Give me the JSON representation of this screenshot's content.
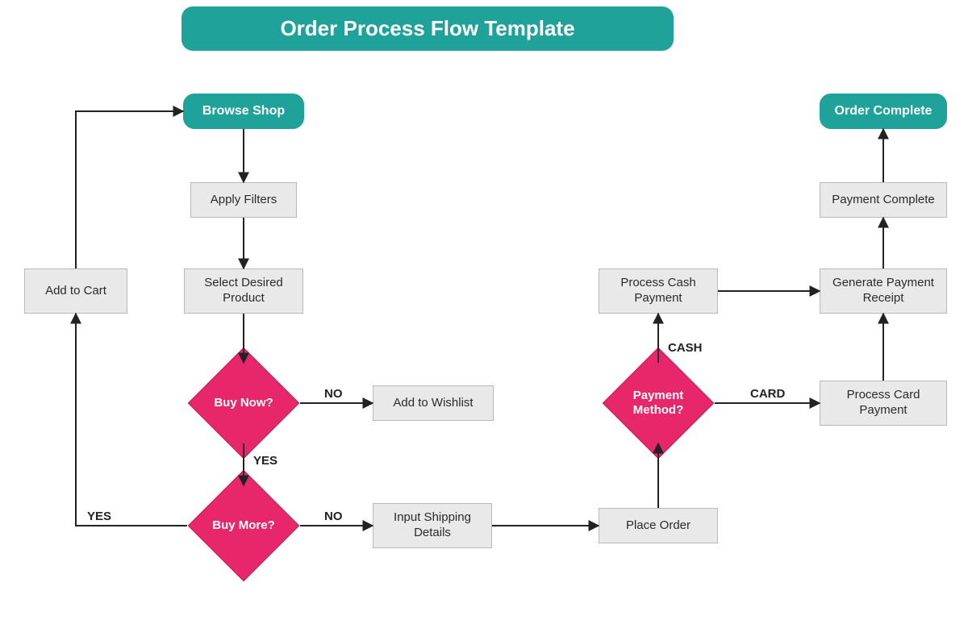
{
  "title": "Order Process Flow Template",
  "nodes": {
    "browse_shop": "Browse Shop",
    "apply_filters": "Apply Filters",
    "select_product": "Select Desired Product",
    "buy_now": "Buy Now?",
    "add_wishlist": "Add to Wishlist",
    "buy_more": "Buy More?",
    "add_cart": "Add to Cart",
    "input_shipping": "Input Shipping Details",
    "place_order": "Place Order",
    "payment_method": "Payment Method?",
    "process_cash": "Process Cash Payment",
    "process_card": "Process Card Payment",
    "generate_receipt": "Generate Payment Receipt",
    "payment_complete": "Payment Complete",
    "order_complete": "Order Complete"
  },
  "edge_labels": {
    "buy_now_no": "NO",
    "buy_now_yes": "YES",
    "buy_more_yes": "YES",
    "buy_more_no": "NO",
    "payment_cash": "CASH",
    "payment_card": "CARD"
  },
  "colors": {
    "teal": "#1fa29a",
    "pink": "#e7276a",
    "process_bg": "#e9e9e9"
  }
}
